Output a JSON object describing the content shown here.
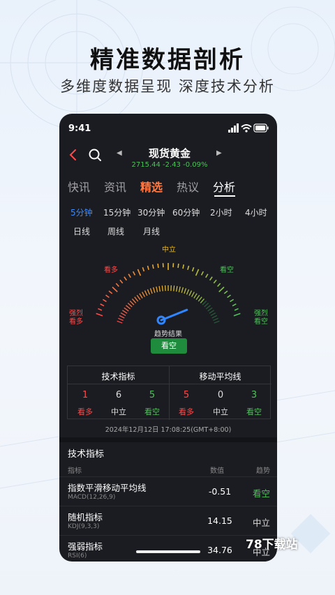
{
  "promo": {
    "title": "精准数据剖析",
    "subtitle": "多维度数据呈现  深度技术分析"
  },
  "status_bar": {
    "time": "9:41"
  },
  "nav": {
    "title": "现货黄金",
    "quote": "2715.44  -2.43  -0.09%",
    "prev_arrow": "◀",
    "next_arrow": "▶"
  },
  "tabs": [
    "快讯",
    "资讯",
    "精选",
    "热议",
    "分析"
  ],
  "periods_row1": [
    "5分钟",
    "15分钟",
    "30分钟",
    "60分钟",
    "2小时",
    "4小时"
  ],
  "periods_row2": [
    "日线",
    "周线",
    "月线"
  ],
  "gauge": {
    "label_neutral": "中立",
    "label_buy": "看多",
    "label_sell": "看空",
    "label_strong_buy": "强烈\n看多",
    "label_strong_sell": "强烈\n看空",
    "trend_label": "趋势结果",
    "trend_result": "看空",
    "needle_value": 0.8
  },
  "summary": {
    "tech_header": "技术指标",
    "ma_header": "移动平均线",
    "tech": [
      {
        "count": "1",
        "label": "看多"
      },
      {
        "count": "6",
        "label": "中立"
      },
      {
        "count": "5",
        "label": "看空"
      }
    ],
    "ma": [
      {
        "count": "5",
        "label": "看多"
      },
      {
        "count": "0",
        "label": "中立"
      },
      {
        "count": "3",
        "label": "看空"
      }
    ]
  },
  "datetime": "2024年12月12日 17:08:25(GMT+8:00)",
  "table": {
    "title": "技术指标",
    "col_name": "指标",
    "col_value": "数值",
    "col_trend": "趋势",
    "rows": [
      {
        "name": "指数平滑移动平均线",
        "sub": "MACD(12,26,9)",
        "value": "-0.51",
        "trend": "看空"
      },
      {
        "name": "随机指标",
        "sub": "KDJ(9,3,3)",
        "value": "14.15",
        "trend": "中立"
      },
      {
        "name": "强弱指标",
        "sub": "RSI(6)",
        "value": "34.76",
        "trend": "中立"
      }
    ]
  },
  "watermark": "78下载站",
  "colors": {
    "buy": "#ff4a4a",
    "sell": "#4fc15b",
    "accent_tab": "#ff7a45",
    "active_period": "#3b8bff",
    "needle": "#2f86ff",
    "neutral_tick": "#e5b82e"
  }
}
